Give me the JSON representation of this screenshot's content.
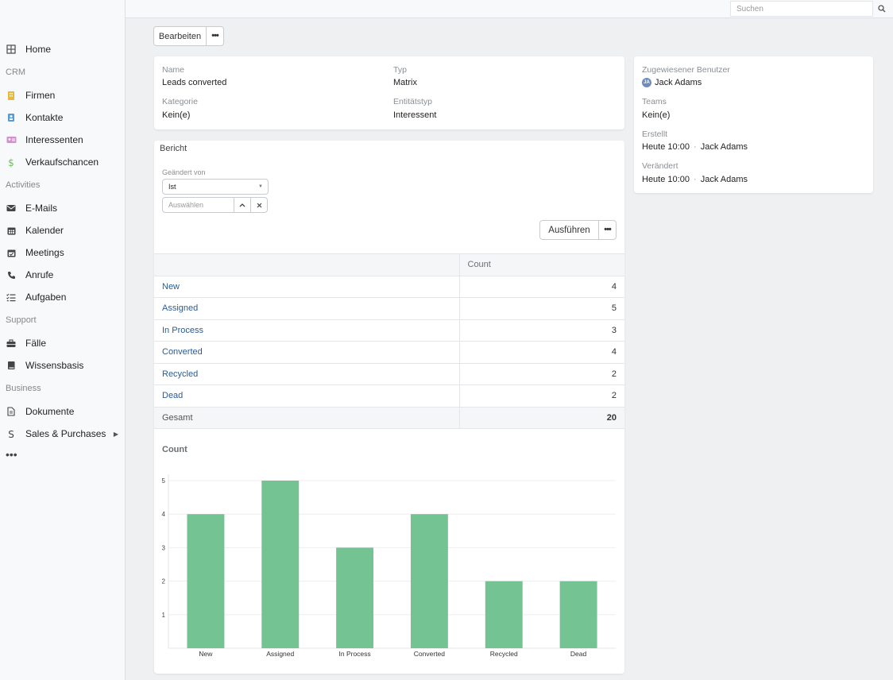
{
  "topbar": {
    "search_placeholder": "Suchen"
  },
  "sidebar": {
    "items": [
      {
        "type": "item",
        "label": "Home",
        "icon": "grid-icon",
        "color": "#555555"
      },
      {
        "type": "group",
        "label": "CRM"
      },
      {
        "type": "item",
        "label": "Firmen",
        "icon": "building-icon",
        "color": "#e8b93a"
      },
      {
        "type": "item",
        "label": "Kontakte",
        "icon": "contact-card-icon",
        "color": "#5b9bd5"
      },
      {
        "type": "item",
        "label": "Interessenten",
        "icon": "id-card-icon",
        "color": "#d48fd1"
      },
      {
        "type": "item",
        "label": "Verkaufschancen",
        "icon": "dollar-icon",
        "color": "#6bbf59"
      },
      {
        "type": "group",
        "label": "Activities"
      },
      {
        "type": "item",
        "label": "E-Mails",
        "icon": "envelope-icon",
        "color": "#444444"
      },
      {
        "type": "item",
        "label": "Kalender",
        "icon": "calendar-icon",
        "color": "#444444"
      },
      {
        "type": "item",
        "label": "Meetings",
        "icon": "calendar-check-icon",
        "color": "#444444"
      },
      {
        "type": "item",
        "label": "Anrufe",
        "icon": "phone-icon",
        "color": "#444444"
      },
      {
        "type": "item",
        "label": "Aufgaben",
        "icon": "task-list-icon",
        "color": "#444444"
      },
      {
        "type": "group",
        "label": "Support"
      },
      {
        "type": "item",
        "label": "Fälle",
        "icon": "briefcase-icon",
        "color": "#444444"
      },
      {
        "type": "item",
        "label": "Wissensbasis",
        "icon": "book-icon",
        "color": "#444444"
      },
      {
        "type": "group",
        "label": "Business"
      },
      {
        "type": "item",
        "label": "Dokumente",
        "icon": "document-icon",
        "color": "#444444"
      },
      {
        "type": "item",
        "label": "Sales & Purchases",
        "icon": "s-letter-icon",
        "color": "#444444",
        "has_submenu": true
      },
      {
        "type": "more",
        "label": "•••"
      }
    ]
  },
  "actions": {
    "edit_label": "Bearbeiten",
    "more_label": "•••"
  },
  "record": {
    "name_label": "Name",
    "name_value": "Leads converted",
    "type_label": "Typ",
    "type_value": "Matrix",
    "category_label": "Kategorie",
    "category_value": "Kein(e)",
    "entity_label": "Entitätstyp",
    "entity_value": "Interessent"
  },
  "side": {
    "assigned_label": "Zugewiesener Benutzer",
    "assigned_initials": "JA",
    "assigned_value": "Jack Adams",
    "teams_label": "Teams",
    "teams_value": "Kein(e)",
    "created_label": "Erstellt",
    "created_time": "Heute 10:00",
    "created_by": "Jack Adams",
    "modified_label": "Verändert",
    "modified_time": "Heute 10:00",
    "modified_by": "Jack Adams",
    "separator": "·"
  },
  "report": {
    "title": "Bericht",
    "filter_label": "Geändert von",
    "filter_operator": "Ist",
    "filter_placeholder": "Auswählen",
    "run_label": "Ausführen",
    "more_label": "•••",
    "table": {
      "header": [
        "",
        "Count"
      ],
      "rows": [
        {
          "label": "New",
          "count": "4"
        },
        {
          "label": "Assigned",
          "count": "5"
        },
        {
          "label": "In Process",
          "count": "3"
        },
        {
          "label": "Converted",
          "count": "4"
        },
        {
          "label": "Recycled",
          "count": "2"
        },
        {
          "label": "Dead",
          "count": "2"
        }
      ],
      "total_label": "Gesamt",
      "total_value": "20"
    }
  },
  "chart_data": {
    "type": "bar",
    "title": "Count",
    "categories": [
      "New",
      "Assigned",
      "In Process",
      "Converted",
      "Recycled",
      "Dead"
    ],
    "values": [
      4,
      5,
      3,
      4,
      2,
      2
    ],
    "ylim": [
      0,
      5
    ],
    "yticks": [
      1,
      2,
      3,
      4,
      5
    ],
    "grid": true,
    "bar_color": "#74c493"
  }
}
